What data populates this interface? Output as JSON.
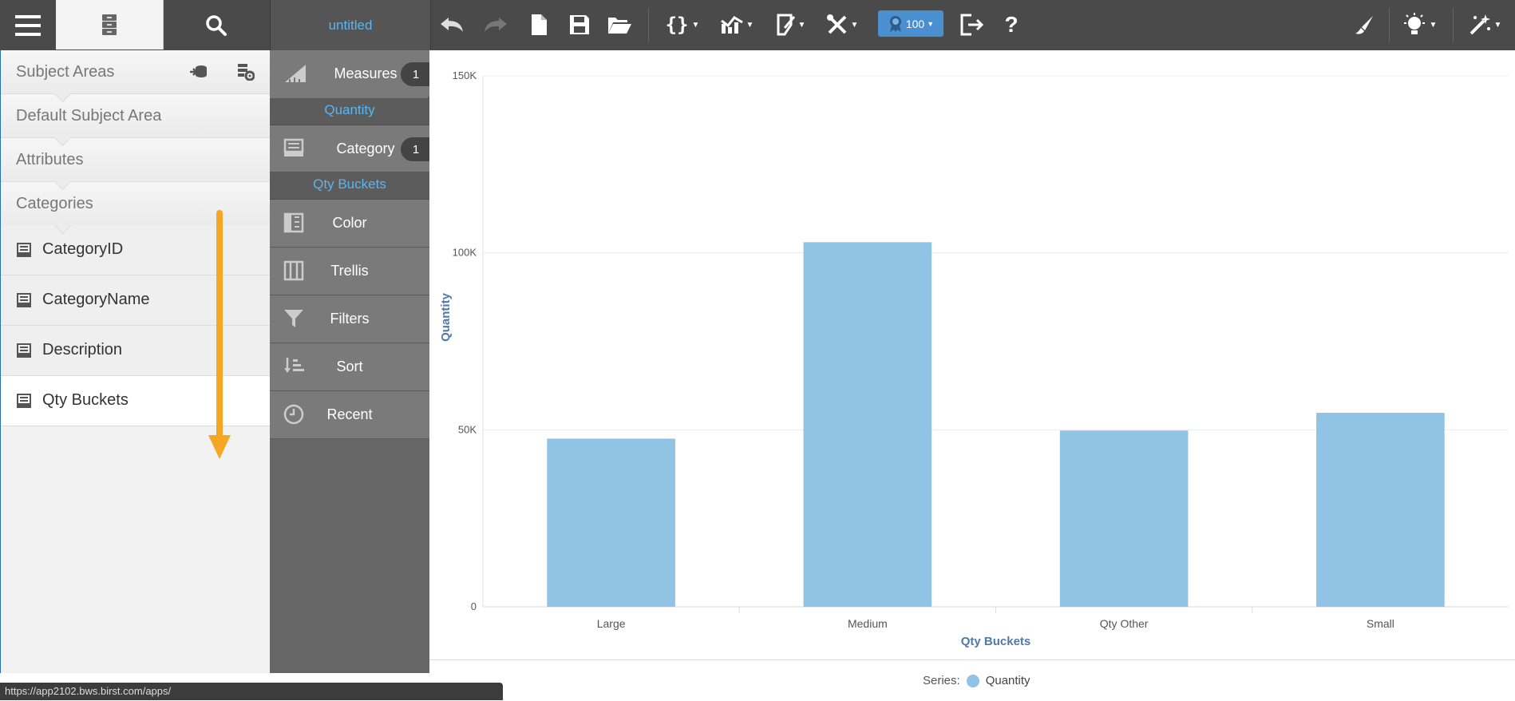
{
  "topbar": {
    "title": "untitled",
    "badge_value": "100"
  },
  "left_panel": {
    "breadcrumbs": [
      "Subject Areas",
      "Default Subject Area",
      "Attributes",
      "Categories"
    ],
    "attributes": [
      "CategoryID",
      "CategoryName",
      "Description",
      "Qty Buckets"
    ],
    "selected_attribute": "Qty Buckets"
  },
  "mid_panel": {
    "measures_label": "Measures",
    "measures_count": "1",
    "measure_item": "Quantity",
    "category_label": "Category",
    "category_count": "1",
    "category_item": "Qty Buckets",
    "color_label": "Color",
    "trellis_label": "Trellis",
    "filters_label": "Filters",
    "sort_label": "Sort",
    "recent_label": "Recent"
  },
  "chart_data": {
    "type": "bar",
    "categories": [
      "Large",
      "Medium",
      "Qty Other",
      "Small"
    ],
    "series": [
      {
        "name": "Quantity",
        "values": [
          47500,
          103000,
          49800,
          54800
        ]
      }
    ],
    "xlabel": "Qty Buckets",
    "ylabel": "Quantity",
    "ylim": [
      0,
      150000
    ],
    "yticks": [
      "0",
      "50K",
      "100K",
      "150K"
    ],
    "grid": true,
    "legend": "bottom-center",
    "bar_color": "#91c3e4"
  },
  "legend": {
    "prefix": "Series:",
    "label": "Quantity"
  },
  "status_bar": {
    "url": "https://app2102.bws.birst.com/apps/"
  }
}
